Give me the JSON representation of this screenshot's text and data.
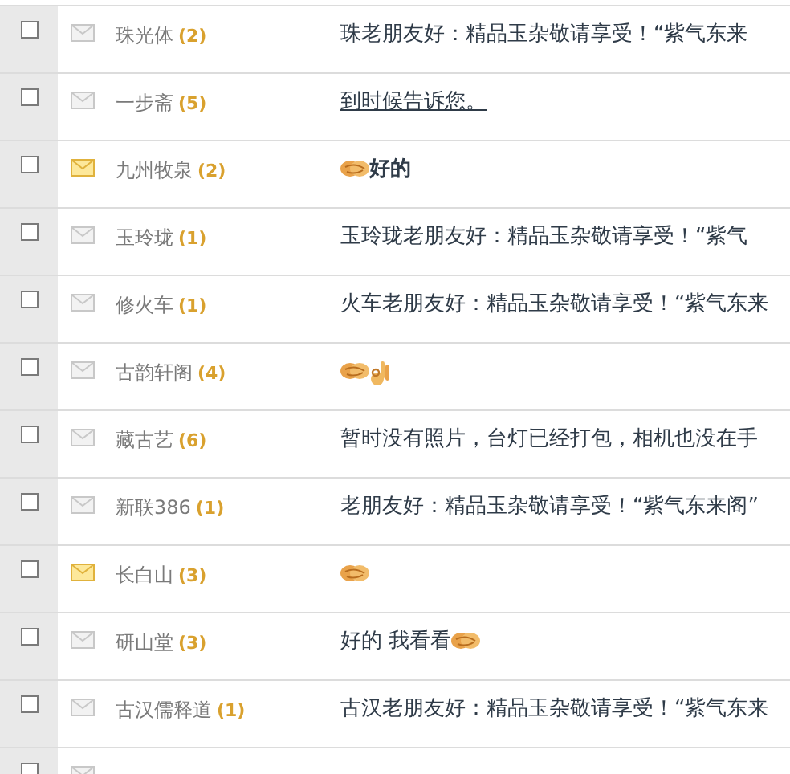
{
  "messages": [
    {
      "checked": false,
      "unread": false,
      "name": "珠光体",
      "count": "(2)",
      "parts": [
        {
          "kind": "text",
          "text": "珠老朋友好：精品玉杂敬请享受！“紫气东来"
        }
      ]
    },
    {
      "checked": false,
      "unread": false,
      "name": "一步斋",
      "count": "(5)",
      "parts": [
        {
          "kind": "link",
          "text": "到时候告诉您。"
        }
      ]
    },
    {
      "checked": false,
      "unread": true,
      "name": "九州牧泉",
      "count": "(2)",
      "parts": [
        {
          "kind": "handshake"
        },
        {
          "kind": "bold",
          "text": "好的"
        }
      ]
    },
    {
      "checked": false,
      "unread": false,
      "name": "玉玲珑",
      "count": "(1)",
      "parts": [
        {
          "kind": "text",
          "text": "玉玲珑老朋友好：精品玉杂敬请享受！“紫气"
        }
      ]
    },
    {
      "checked": false,
      "unread": false,
      "name": "修火车",
      "count": "(1)",
      "parts": [
        {
          "kind": "text",
          "text": "火车老朋友好：精品玉杂敬请享受！“紫气东来"
        }
      ]
    },
    {
      "checked": false,
      "unread": false,
      "name": "古韵轩阁",
      "count": "(4)",
      "parts": [
        {
          "kind": "handshake"
        },
        {
          "kind": "ok-hand"
        }
      ]
    },
    {
      "checked": false,
      "unread": false,
      "name": "藏古艺",
      "count": "(6)",
      "parts": [
        {
          "kind": "text",
          "text": "暂时没有照片，台灯已经打包，相机也没在手"
        }
      ]
    },
    {
      "checked": false,
      "unread": false,
      "name": "新联386",
      "count": "(1)",
      "parts": [
        {
          "kind": "text",
          "text": "老朋友好：精品玉杂敬请享受！“紫气东来阁”"
        }
      ]
    },
    {
      "checked": false,
      "unread": true,
      "name": "长白山",
      "count": "(3)",
      "parts": [
        {
          "kind": "handshake"
        }
      ]
    },
    {
      "checked": false,
      "unread": false,
      "name": "研山堂",
      "count": "(3)",
      "parts": [
        {
          "kind": "text",
          "text": "好的 我看看"
        },
        {
          "kind": "handshake"
        }
      ]
    },
    {
      "checked": false,
      "unread": false,
      "name": "古汉儒释道",
      "count": "(1)",
      "parts": [
        {
          "kind": "text",
          "text": "古汉老朋友好：精品玉杂敬请享受！“紫气东来"
        }
      ]
    },
    {
      "checked": false,
      "unread": false
    }
  ]
}
